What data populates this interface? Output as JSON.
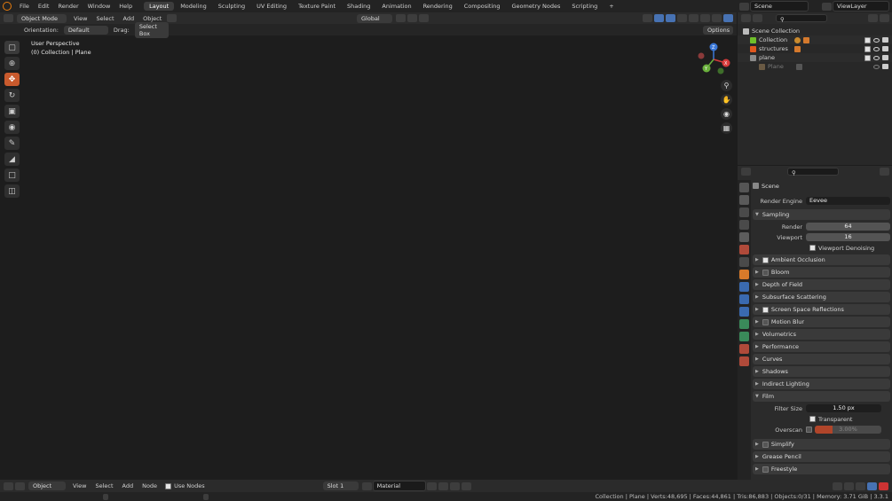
{
  "topbar": {
    "menus": [
      "File",
      "Edit",
      "Render",
      "Window",
      "Help"
    ],
    "workspaces": [
      "Layout",
      "Modeling",
      "Sculpting",
      "UV Editing",
      "Texture Paint",
      "Shading",
      "Animation",
      "Rendering",
      "Compositing",
      "Geometry Nodes",
      "Scripting"
    ],
    "active_workspace": "Layout",
    "add_tab": "+",
    "scene": "Scene",
    "view_layer": "ViewLayer"
  },
  "viewport_header": {
    "mode": "Object Mode",
    "menus": [
      "View",
      "Select",
      "Add",
      "Object"
    ],
    "orientation_global": "Global"
  },
  "tool_settings": {
    "orientation_label": "Orientation:",
    "orientation_value": "Default",
    "drag_label": "Drag:",
    "drag_value": "Select Box",
    "options": "Options"
  },
  "viewport": {
    "perspective": "User Perspective",
    "collection_info": "(0) Collection | Plane",
    "gizmo_axes": [
      "X",
      "Y",
      "Z"
    ]
  },
  "outliner": {
    "root": "Scene Collection",
    "items": [
      {
        "name": "Collection",
        "color": "#6fbf2a"
      },
      {
        "name": "structures",
        "color": "#e0571e"
      },
      {
        "name": "plane",
        "color": "#8a8a8a"
      },
      {
        "name": "Plane",
        "color": "#8a8a8a"
      }
    ]
  },
  "properties": {
    "context": "Scene",
    "render_engine_label": "Render Engine",
    "render_engine": "Eevee",
    "sampling": {
      "title": "Sampling",
      "render_label": "Render",
      "render_value": "64",
      "viewport_label": "Viewport",
      "viewport_value": "16",
      "denoise": "Viewport Denoising"
    },
    "panels": [
      {
        "label": "Ambient Occlusion",
        "checkbox": true,
        "checked": true
      },
      {
        "label": "Bloom",
        "checkbox": true,
        "checked": false
      },
      {
        "label": "Depth of Field",
        "checkbox": false,
        "checked": false
      },
      {
        "label": "Subsurface Scattering",
        "checkbox": false,
        "checked": false
      },
      {
        "label": "Screen Space Reflections",
        "checkbox": true,
        "checked": true
      },
      {
        "label": "Motion Blur",
        "checkbox": true,
        "checked": false
      },
      {
        "label": "Volumetrics",
        "checkbox": false,
        "checked": false
      },
      {
        "label": "Performance",
        "checkbox": false,
        "checked": false
      },
      {
        "label": "Curves",
        "checkbox": false,
        "checked": false
      },
      {
        "label": "Shadows",
        "checkbox": false,
        "checked": false
      },
      {
        "label": "Indirect Lighting",
        "checkbox": false,
        "checked": false
      }
    ],
    "film": {
      "title": "Film",
      "filter_label": "Filter Size",
      "filter_value": "1.50 px",
      "transparent": "Transparent",
      "overscan_label": "Overscan",
      "overscan_value": "3.00%"
    },
    "bottom_panels": [
      {
        "label": "Simplify",
        "checkbox": true
      },
      {
        "label": "Grease Pencil",
        "checkbox": false
      },
      {
        "label": "Freestyle",
        "checkbox": true
      }
    ]
  },
  "bottombar": {
    "mode": "Object",
    "menus": [
      "View",
      "Select",
      "Add",
      "Node"
    ],
    "use_nodes": "Use Nodes",
    "slot": "Slot 1",
    "material": "Material"
  },
  "status": "Collection | Plane | Verts:48,695 | Faces:44,861 | Tris:86,883 | Objects:0/31 | Memory: 3.71 GiB | 3.3.1"
}
